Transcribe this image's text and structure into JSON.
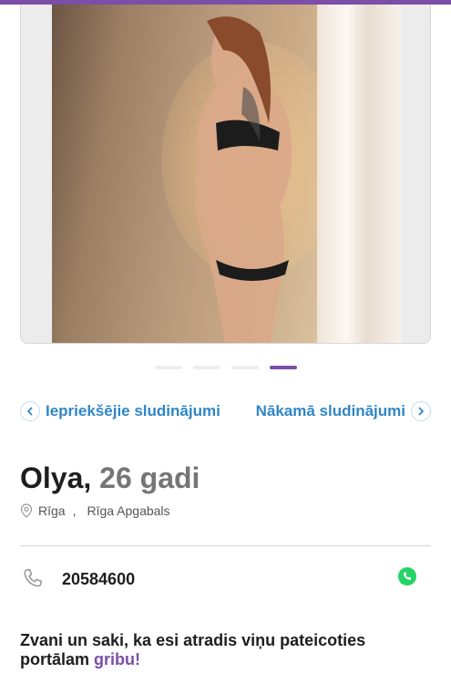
{
  "navigation": {
    "prev_label": "Iepriekšējie sludinājumi",
    "next_label": "Nākamā sludinājumi"
  },
  "gallery": {
    "photo_count": 4,
    "active_index": 4
  },
  "profile": {
    "name": "Olya,",
    "age": "26 gadi",
    "city": "Rīga",
    "city_separator": ",",
    "region": "Rīga Apgabals",
    "phone": "20584600"
  },
  "promo": {
    "text": "Zvani un saki, ka esi atradis viņu pateicoties portālam",
    "brand": "gribu!"
  },
  "icons": {
    "prev": "chevron-left-icon",
    "next": "chevron-right-icon",
    "location": "map-pin-icon",
    "phone": "phone-icon",
    "whatsapp": "whatsapp-icon"
  },
  "colors": {
    "accent": "#7b4ea8",
    "link": "#2f86c7",
    "whatsapp": "#25d366"
  }
}
